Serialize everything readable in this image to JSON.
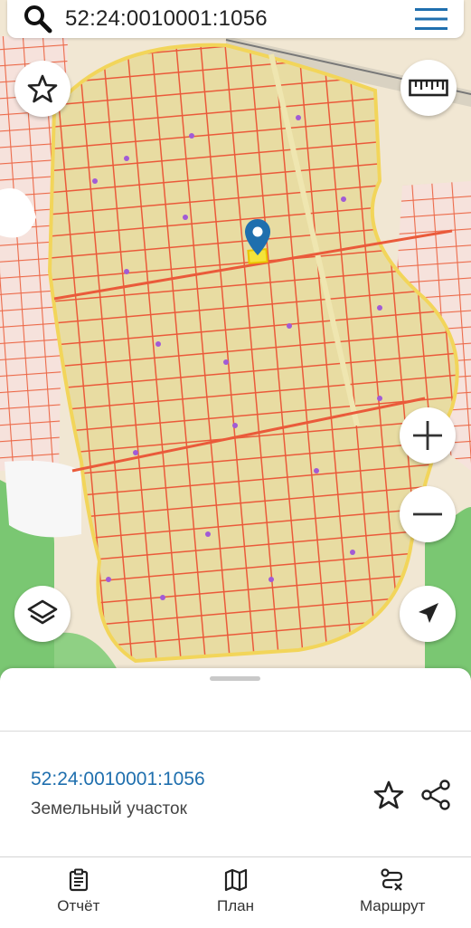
{
  "search": {
    "query": "52:24:0010001:1056"
  },
  "map": {
    "icons": {
      "favorite": "star-icon",
      "ruler": "ruler-icon",
      "layers": "layers-icon",
      "zoom_in": "plus-icon",
      "zoom_out": "minus-icon",
      "location": "navigation-arrow-icon",
      "pin": "map-pin-icon"
    },
    "colors": {
      "parcel_border": "#ea5a3a",
      "parcel_fill": "#e6dba0",
      "selected": "#f2e033",
      "pin": "#1f6fae",
      "forest": "#6cc06a"
    }
  },
  "sheet": {
    "cadastral_number": "52:24:0010001:1056",
    "object_type": "Земельный участок"
  },
  "nav": {
    "items": [
      {
        "label": "Отчёт",
        "icon": "report-icon"
      },
      {
        "label": "План",
        "icon": "map-icon"
      },
      {
        "label": "Маршрут",
        "icon": "route-icon"
      }
    ]
  }
}
